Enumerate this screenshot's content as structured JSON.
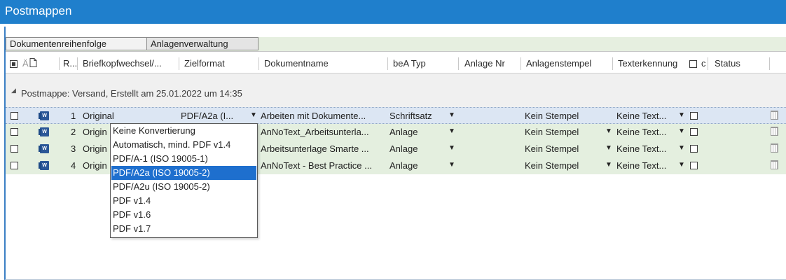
{
  "window": {
    "title": "Postmappen"
  },
  "tabs": [
    {
      "label": "Dokumentenreihenfolge"
    },
    {
      "label": "Anlagenverwaltung"
    }
  ],
  "columns": {
    "col_a": "Ä",
    "r": "R...",
    "briefkopf": "Briefkopfwechsel/...",
    "zielformat": "Zielformat",
    "dokumentname": "Dokumentname",
    "bea_typ": "beA Typ",
    "anlage_nr": "Anlage Nr",
    "anlagenstempel": "Anlagenstempel",
    "texterkennung": "Texterkennung",
    "col_c": "c",
    "status": "Status"
  },
  "group": {
    "label": "Postmappe: Versand, Erstellt am 25.01.2022 um 14:35"
  },
  "rows": [
    {
      "r": "1",
      "briefkopf": "Original",
      "zielformat": "PDF/A2a (I...",
      "dokumentname": "Arbeiten mit Dokumente...",
      "bea_typ": "Schriftsatz",
      "anlagenstempel": "Kein Stempel",
      "texterkennung": "Keine Text..."
    },
    {
      "r": "2",
      "briefkopf": "Origin",
      "zielformat": "",
      "dokumentname": "AnNoText_Arbeitsunterla...",
      "bea_typ": "Anlage",
      "anlagenstempel": "Kein Stempel",
      "texterkennung": "Keine Text..."
    },
    {
      "r": "3",
      "briefkopf": "Origin",
      "zielformat": "",
      "dokumentname": "Arbeitsunterlage Smarte ...",
      "bea_typ": "Anlage",
      "anlagenstempel": "Kein Stempel",
      "texterkennung": "Keine Text..."
    },
    {
      "r": "4",
      "briefkopf": "Origin",
      "zielformat": "",
      "dokumentname": "AnNoText - Best Practice ...",
      "bea_typ": "Anlage",
      "anlagenstempel": "Kein Stempel",
      "texterkennung": "Keine Text..."
    }
  ],
  "dropdown": {
    "options": [
      "Keine Konvertierung",
      "Automatisch, mind. PDF v1.4",
      "PDF/A-1 (ISO 19005-1)",
      "PDF/A2a (ISO 19005-2)",
      "PDF/A2u (ISO 19005-2)",
      "PDF v1.4",
      "PDF v1.6",
      "PDF v1.7"
    ],
    "selected": "PDF/A2a (ISO 19005-2)"
  },
  "icons": {
    "word": "W",
    "dropdown_arrow": "▼",
    "collapse": "◢"
  },
  "colors": {
    "titlebar": "#1f7fcc",
    "row_selected": "#dce6f3",
    "row_normal": "#e4efdf",
    "dropdown_highlight": "#1e6fce"
  }
}
